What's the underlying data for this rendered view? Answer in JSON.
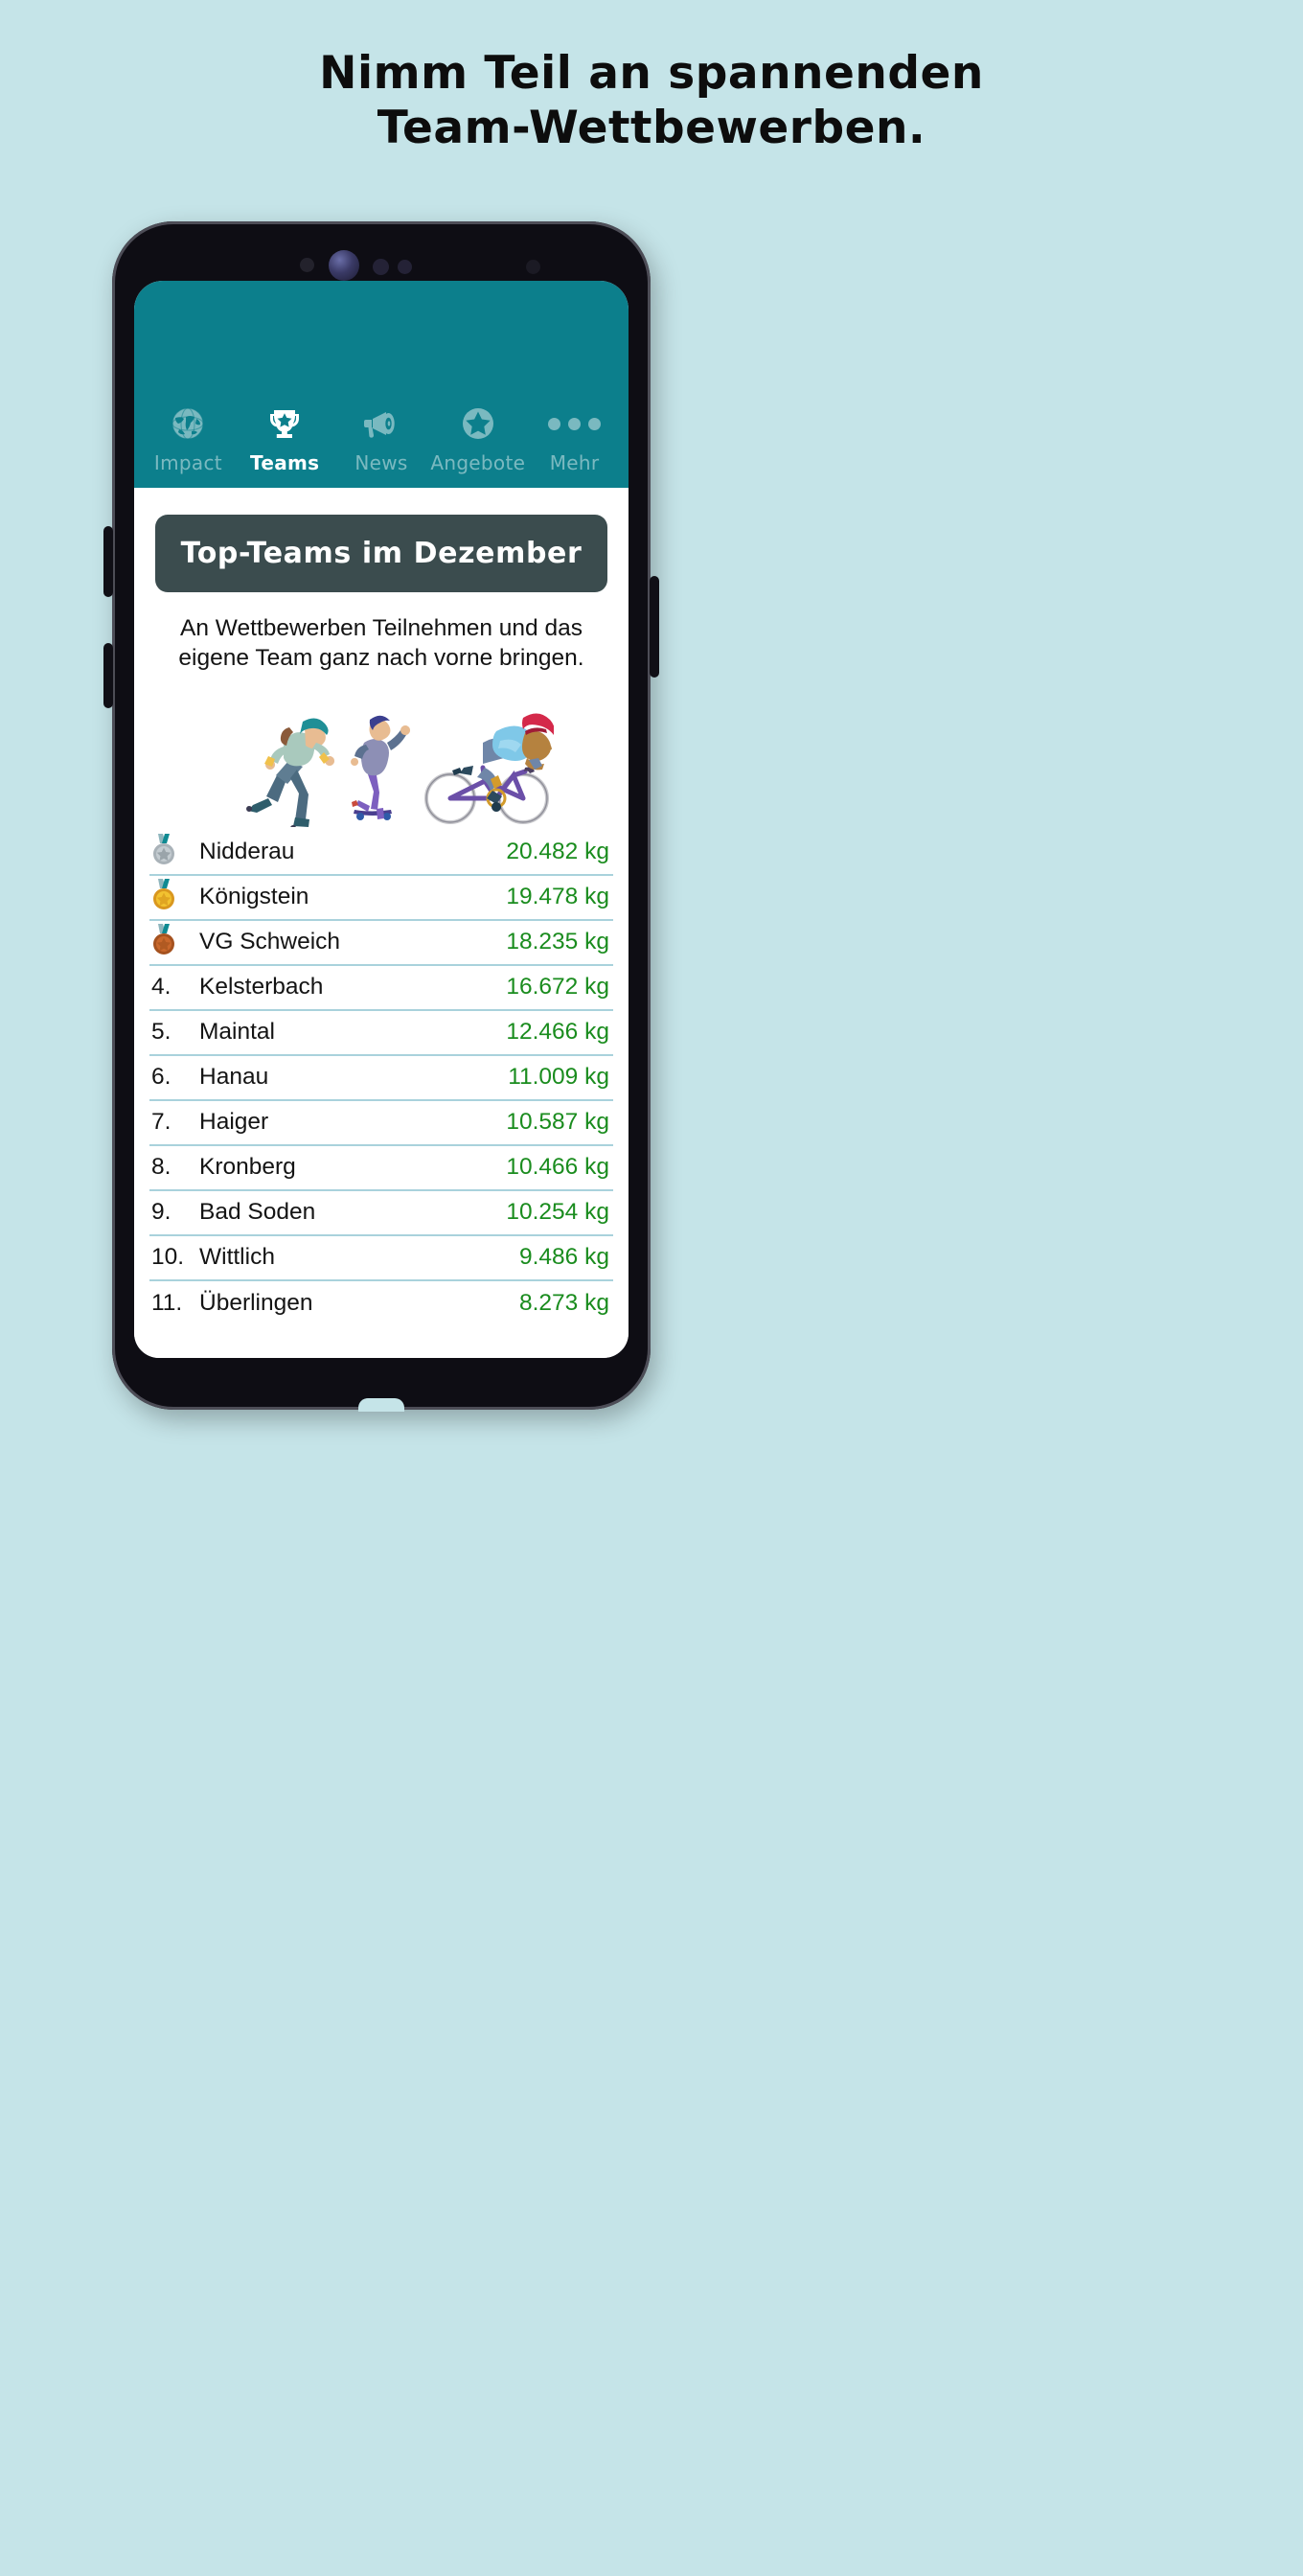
{
  "headline": {
    "line1": "Nimm Teil an spannenden",
    "line2": "Team-Wettbewerben."
  },
  "colors": {
    "page_background": "#c5e4e8",
    "tabbar_teal": "#0c7f8c",
    "title_card_dark": "#3b4c4e",
    "value_green": "#1a8c1e",
    "row_divider": "#a9d2dc",
    "phone_body": "#0e0d14"
  },
  "tabbar": {
    "items": [
      {
        "label": "Impact",
        "icon": "globe-icon",
        "active": false
      },
      {
        "label": "Teams",
        "icon": "trophy-icon",
        "active": true
      },
      {
        "label": "News",
        "icon": "megaphone-icon",
        "active": false
      },
      {
        "label": "Angebote",
        "icon": "star-circle-icon",
        "active": false
      },
      {
        "label": "Mehr",
        "icon": "more-dots-icon",
        "active": false
      }
    ]
  },
  "content": {
    "title": "Top-Teams im Dezember",
    "subtitle": "An Wettbewerben Teilnehmen und das eigene Team ganz nach vorne bringen.",
    "illustration": "sports-people-illustration"
  },
  "leaderboard": {
    "rows": [
      {
        "rank": "",
        "medal": "silver-medal-icon",
        "team": "Nidderau",
        "value": "20.482 kg"
      },
      {
        "rank": "",
        "medal": "gold-medal-icon",
        "team": "Königstein",
        "value": "19.478 kg"
      },
      {
        "rank": "",
        "medal": "bronze-medal-icon",
        "team": "VG Schweich",
        "value": "18.235 kg"
      },
      {
        "rank": "4.",
        "medal": "",
        "team": "Kelsterbach",
        "value": "16.672 kg"
      },
      {
        "rank": "5.",
        "medal": "",
        "team": "Maintal",
        "value": "12.466 kg"
      },
      {
        "rank": "6.",
        "medal": "",
        "team": "Hanau",
        "value": "11.009 kg"
      },
      {
        "rank": "7.",
        "medal": "",
        "team": "Haiger",
        "value": "10.587 kg"
      },
      {
        "rank": "8.",
        "medal": "",
        "team": "Kronberg",
        "value": "10.466 kg"
      },
      {
        "rank": "9.",
        "medal": "",
        "team": "Bad Soden",
        "value": "10.254 kg"
      },
      {
        "rank": "10.",
        "medal": "",
        "team": "Wittlich",
        "value": "9.486 kg"
      },
      {
        "rank": "11.",
        "medal": "",
        "team": "Überlingen",
        "value": "8.273 kg"
      }
    ]
  }
}
